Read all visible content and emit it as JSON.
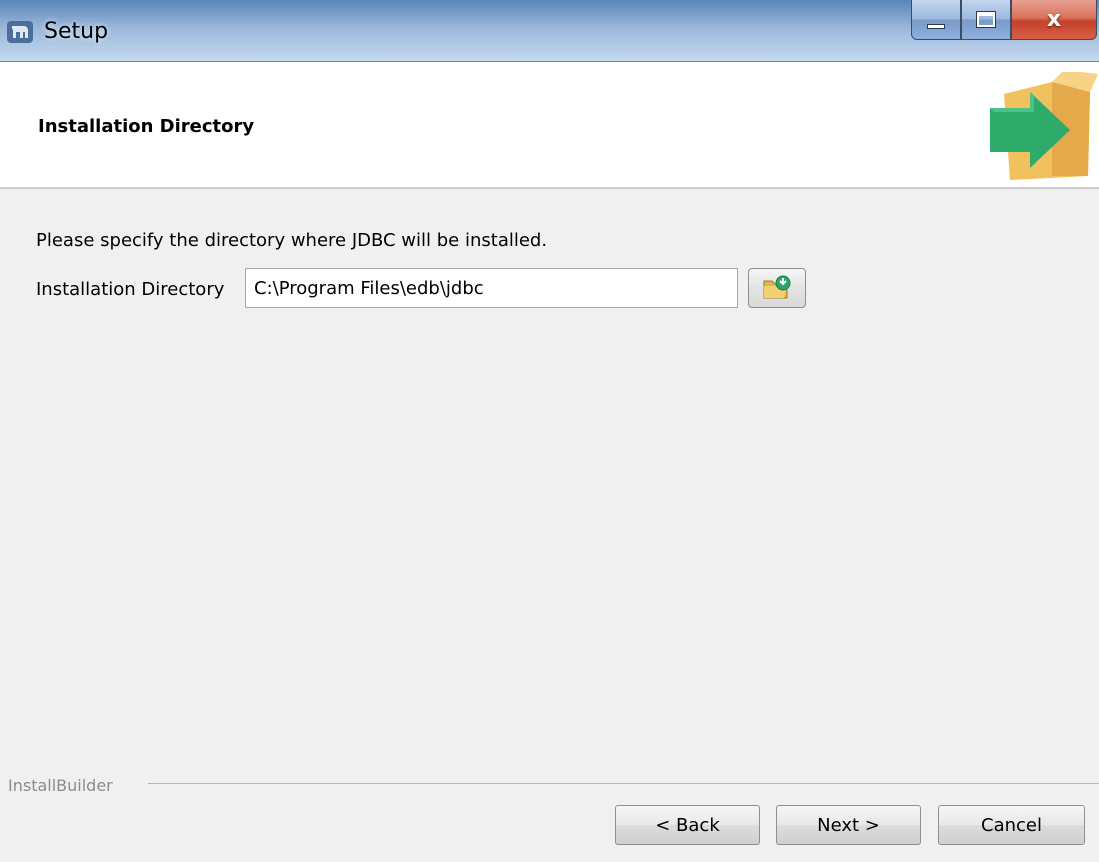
{
  "window": {
    "title": "Setup",
    "icon": "elephant-app-icon",
    "controls": [
      "minimize-icon",
      "maximize-icon",
      "close-icon"
    ],
    "close_glyph": "x"
  },
  "header": {
    "title": "Installation Directory",
    "icon": "install-box-arrow-icon"
  },
  "main": {
    "prompt": "Please specify the directory where JDBC will be installed.",
    "directory_label": "Installation Directory",
    "directory_value": "C:\\Program Files\\edb\\jdbc",
    "browse_icon": "folder-browse-icon"
  },
  "footer": {
    "brand": "InstallBuilder",
    "back_label": "< Back",
    "next_label": "Next >",
    "cancel_label": "Cancel"
  },
  "colors": {
    "titlebar": "#7a9bc8",
    "close_button": "#c5412a",
    "background": "#f0f0f0",
    "box": "#f0c060",
    "arrow": "#2eaa6a"
  }
}
